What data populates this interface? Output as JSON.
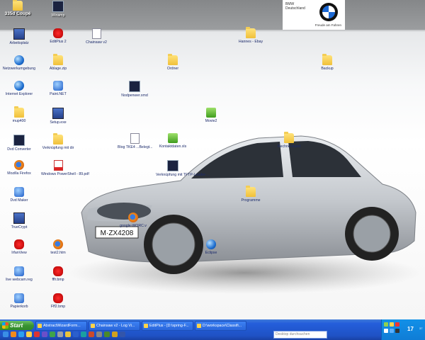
{
  "banner": {
    "brand_line1": "BMW",
    "brand_line2": "Deutschland",
    "tagline": "Freude am Fahren",
    "logo_colors": {
      "blue": "#1c69d4",
      "black": "#111111",
      "white": "#ffffff"
    }
  },
  "desktop_icons": [
    {
      "label": "335d Coupé",
      "glyph": "folder-icon",
      "emph": true
    },
    {
      "label": "Arbeitsplatz",
      "glyph": "computer-icon"
    },
    {
      "label": "Netzwerkumgebung",
      "glyph": "network-icon"
    },
    {
      "label": "Internet Explorer",
      "glyph": "ie-icon"
    },
    {
      "label": "mup400",
      "glyph": "folder-icon"
    },
    {
      "label": "Dvd Converter",
      "glyph": "dvd-icon"
    },
    {
      "label": "Mozilla Firefox",
      "glyph": "firefox-icon"
    },
    {
      "label": "Dvd Maker",
      "glyph": "dvd-icon"
    },
    {
      "label": "TrueCrypt",
      "glyph": "truecrypt-icon"
    },
    {
      "label": "IrfanView",
      "glyph": "red-splat-icon"
    },
    {
      "label": "live webcam.reg",
      "glyph": "registry-icon"
    },
    {
      "label": "Papierkorb",
      "glyph": "recycle-bin-icon"
    },
    {
      "label": "Winamp",
      "glyph": "winamp-icon"
    },
    {
      "label": "EditPlus 2",
      "glyph": "editplus-icon"
    },
    {
      "label": "Ablage.zip",
      "glyph": "zip-icon"
    },
    {
      "label": "Paint.NET",
      "glyph": "paint-icon"
    },
    {
      "label": "Setup.exe",
      "glyph": "setup-icon"
    },
    {
      "label": "Verknüpfung mit dir",
      "glyph": "folder-icon"
    },
    {
      "label": "Windows PowerShell - 89.pdf",
      "glyph": "pdf-icon"
    },
    {
      "label": "Chainsaw v2",
      "glyph": "document-icon"
    },
    {
      "label": "test2.htm",
      "glyph": "firefox-icon"
    },
    {
      "label": "fffr.bmp",
      "glyph": "red-splat-icon"
    },
    {
      "label": "Fff2.bmp",
      "glyph": "red-splat-icon"
    },
    {
      "label": "google-WORC.v",
      "glyph": "firefox-icon"
    },
    {
      "label": "Ordner",
      "glyph": "folder-icon"
    },
    {
      "label": "Hannes - Ebay",
      "glyph": "folder-icon"
    },
    {
      "label": "Backup",
      "glyph": "folder-icon"
    },
    {
      "label": "Nodpenwer.xmd",
      "glyph": "app-icon"
    },
    {
      "label": "Movie2",
      "glyph": "folder-check-icon"
    },
    {
      "label": "Blog TKE4 ...Belegt...",
      "glyph": "word-icon"
    },
    {
      "label": "Kontaktdaten.xls",
      "glyph": "excel-icon"
    },
    {
      "label": "Verknüpfung mit TFTP-Loader-...",
      "glyph": "app-icon"
    },
    {
      "label": "Programme",
      "glyph": "folder-icon"
    },
    {
      "label": "Eclipse",
      "glyph": "eclipse-icon"
    },
    {
      "label": "Rechnerstand",
      "glyph": "folder-icon"
    }
  ],
  "taskbar": {
    "start_label": "Start",
    "tasks": [
      {
        "label": "AbstractWizardForm..."
      },
      {
        "label": "Chainsaw v2 - Log Vi..."
      },
      {
        "label": "EditPlus - [D:\\spring-F..."
      },
      {
        "label": "D:\\workspace\\Classifi..."
      }
    ],
    "search_placeholder": "Desktop durchsuchen",
    "clock": "17",
    "clock_minutes": "37",
    "colors": {
      "taskbar": "#245edb",
      "start": "#3a9433",
      "tray": "#1290e8"
    }
  }
}
